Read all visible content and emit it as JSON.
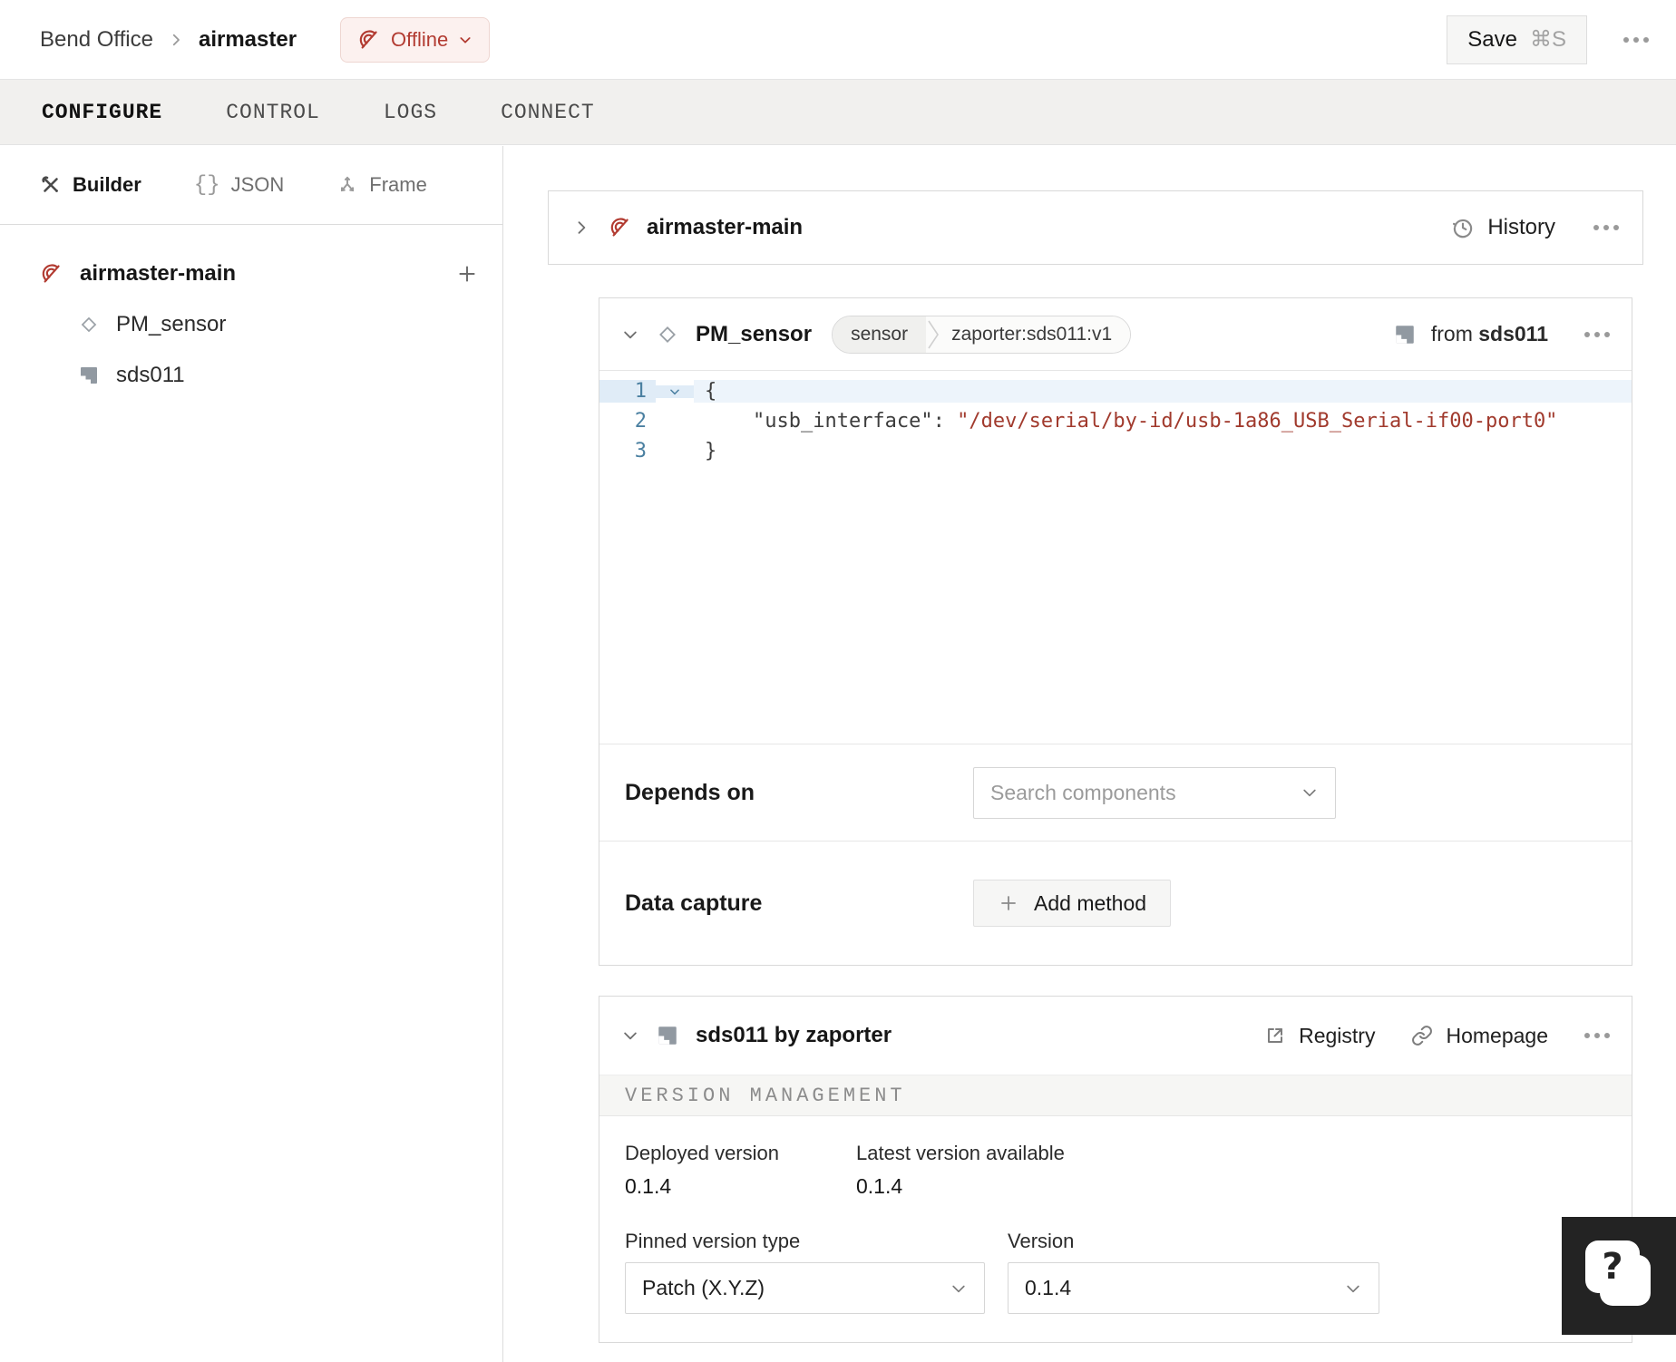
{
  "header": {
    "breadcrumb": [
      "Bend Office",
      "airmaster"
    ],
    "status_label": "Offline",
    "save_label": "Save",
    "save_shortcut": "⌘S"
  },
  "tabs": [
    {
      "label": "CONFIGURE",
      "active": true
    },
    {
      "label": "CONTROL",
      "active": false
    },
    {
      "label": "LOGS",
      "active": false
    },
    {
      "label": "CONNECT",
      "active": false
    }
  ],
  "sidebar": {
    "view_tabs": [
      {
        "label": "Builder",
        "icon": "tools-icon",
        "active": true
      },
      {
        "label": "JSON",
        "icon": "braces-icon",
        "active": false
      },
      {
        "label": "Frame",
        "icon": "frame-axes-icon",
        "active": false
      }
    ],
    "tree": {
      "root_label": "airmaster-main",
      "root_icon": "offline-wifi-icon",
      "children": [
        {
          "label": "PM_sensor",
          "icon": "component-diamond-icon"
        },
        {
          "label": "sds011",
          "icon": "module-icon"
        }
      ]
    }
  },
  "main": {
    "machine_card": {
      "title": "airmaster-main",
      "history_label": "History"
    },
    "pm": {
      "title": "PM_sensor",
      "badge_type": "sensor",
      "badge_model": "zaporter:sds011:v1",
      "from_prefix": "from",
      "from_module": "sds011",
      "code": {
        "n1": "1",
        "n2": "2",
        "n3": "3",
        "line1": "{",
        "indent": "    ",
        "key": "\"usb_interface\"",
        "colon": ": ",
        "value": "\"/dev/serial/by-id/usb-1a86_USB_Serial-if00-port0\"",
        "line3": "}"
      },
      "depends_label": "Depends on",
      "depends_placeholder": "Search components",
      "capture_label": "Data capture",
      "add_method_label": "Add method"
    },
    "module_card": {
      "title": "sds011 by zaporter",
      "registry_label": "Registry",
      "homepage_label": "Homepage",
      "section_title": "VERSION MANAGEMENT",
      "deployed_label": "Deployed version",
      "deployed_value": "0.1.4",
      "latest_label": "Latest version available",
      "latest_value": "0.1.4",
      "pinned_label": "Pinned version type",
      "pinned_value": "Patch (X.Y.Z)",
      "version_label": "Version",
      "version_value": "0.1.4"
    }
  },
  "help": {
    "question": "?"
  },
  "colors": {
    "accent_red": "#b23b31",
    "status_badge_bg": "#fcf1ef",
    "code_string_red": "#a13a2d",
    "line_number_blue": "#4b80a1",
    "tabbar_bg": "#f1f0ee"
  }
}
